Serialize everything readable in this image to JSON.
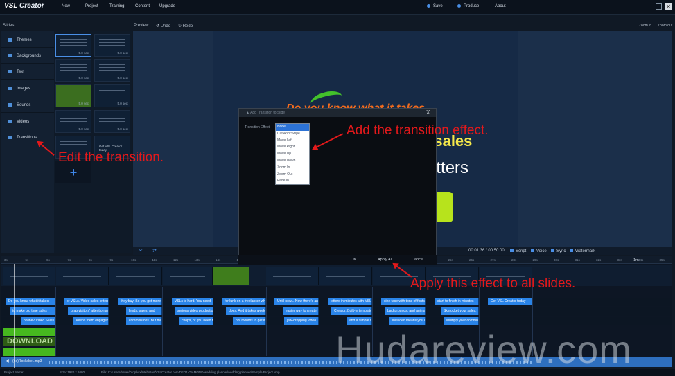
{
  "app": {
    "logo_prefix": "VSL",
    "logo_rest": " Creator"
  },
  "menu": {
    "new": "New",
    "project": "Project",
    "training": "Training",
    "content": "Content",
    "upgrade": "Upgrade",
    "save": "Save",
    "produce": "Produce",
    "about": "About"
  },
  "subheader": {
    "slides": "Slides",
    "preview": "Preview",
    "undo": "Undo",
    "redo": "Redo",
    "zoom_in": "Zoom in",
    "zoom_out": "Zoom out"
  },
  "sidebar": {
    "items": [
      "Themes",
      "Backgrounds",
      "Text",
      "Images",
      "Sounds",
      "Videos",
      "Transitions"
    ]
  },
  "slides": {
    "durations": [
      "5.0 sec",
      "5.0 sec",
      "5.0 sec",
      "5.0 sec",
      "5.0 sec",
      "5.0 sec",
      "5.0 sec",
      "5.0 sec"
    ],
    "last_label": "Get VSL Creator today",
    "add": "+"
  },
  "stage": {
    "title": "Do you know what it takes",
    "line2": "e sales",
    "line3": "s Letters"
  },
  "preview_bar": {
    "time": "00:01.36 / 00:50.00",
    "script": "Script",
    "voice": "Voice",
    "sync": "Sync",
    "watermark": "Watermark"
  },
  "dialog": {
    "title": "Add Transition to Slide",
    "close": "X",
    "label": "Transition Effect",
    "options": [
      "None",
      "Cut And Swipe",
      "Move Left",
      "Move Right",
      "Move Up",
      "Move Down",
      "Zoom In",
      "Zoom Out",
      "Fade In"
    ],
    "ok": "OK",
    "apply_all": "Apply All",
    "cancel": "Cancel"
  },
  "annotations": {
    "edit": "Edit the transition.",
    "add": "Add the transition effect.",
    "apply": "Apply this effect to all slides."
  },
  "timeline": {
    "ticks": [
      "3s",
      "5s",
      "6s",
      "7s",
      "8s",
      "9s",
      "10s",
      "11s",
      "12s",
      "13s",
      "14s",
      "15s",
      "16s",
      "17s",
      "18s",
      "19s",
      "20s",
      "21s",
      "22s",
      "23s",
      "24s",
      "25s",
      "26s",
      "27s",
      "28s",
      "29s",
      "30s",
      "31s",
      "32s",
      "33s",
      "34s",
      "35s"
    ],
    "end_tick": "1m",
    "row1": [
      "Do you know what it takes",
      "or VSLs. Video sales letters",
      "they buy. So you got more",
      "VSLs is hard. You need",
      "for lunk on a freelancer who",
      "Until now... Now there's an",
      "letters in minutes with VSL",
      "cine face with tons of fonts",
      "start to finish in minutes",
      "Get VSL Creator today"
    ],
    "row2": [
      "to make big time sales",
      "grab visitors' attention and",
      "leads, sales, and",
      "serious video production",
      "does. And it takes weeks",
      "easier way to create",
      "Creator. Built-in templates",
      "backgrounds, and animations",
      "Skyrocket your sales."
    ],
    "row3": [
      "online? Video Sales L",
      "keeps them engaged",
      "commissions. But ma",
      "chops, or you need to",
      "not months to get it m",
      "jaw-dropping video",
      "and a simple drag an",
      "included means you c",
      "Multiply your commis"
    ],
    "download": "DOWNLOAD",
    "audio": "(no)Rockabe...mp3"
  },
  "status": {
    "project": "Project Name:",
    "size": "Size: 1920 x 1080",
    "file": "File: C:/Users/bevel/Dropbox/Websites/VSLCreator.com/DFO1-DIAMOND/wedding planner/wedding planner/Sample Project.vmp"
  },
  "watermark": "Hudareview.com",
  "colors": {
    "accent": "#2a84e8",
    "annotation": "#e3191b",
    "stage_green": "#b7e31c"
  }
}
